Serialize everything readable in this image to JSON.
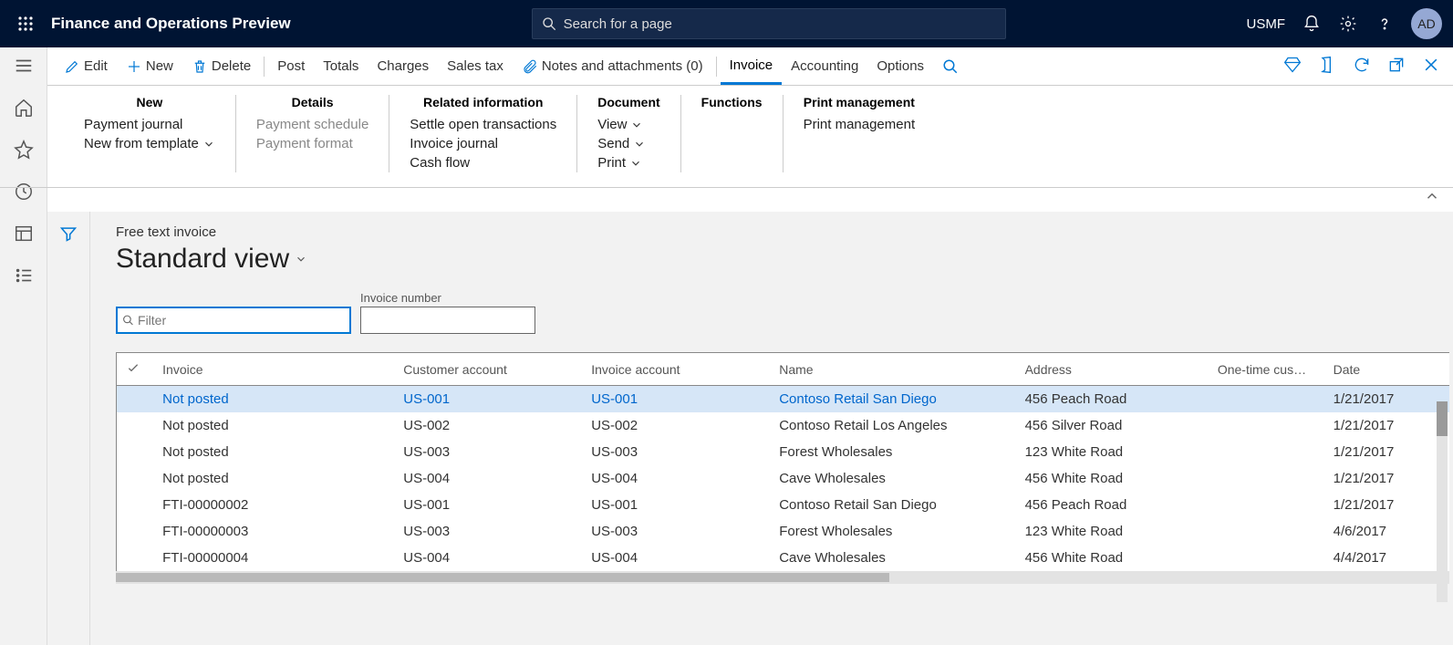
{
  "header": {
    "app_title": "Finance and Operations Preview",
    "search_placeholder": "Search for a page",
    "company": "USMF",
    "avatar": "AD"
  },
  "actionbar": {
    "edit": "Edit",
    "new": "New",
    "delete": "Delete",
    "post": "Post",
    "totals": "Totals",
    "charges": "Charges",
    "salestax": "Sales tax",
    "attachments": "Notes and attachments (0)",
    "invoice": "Invoice",
    "accounting": "Accounting",
    "options": "Options"
  },
  "ribbon": {
    "groups": [
      {
        "head": "New",
        "items": [
          {
            "label": "Payment journal",
            "disabled": false
          },
          {
            "label": "New from template",
            "disabled": false,
            "chevron": true
          }
        ]
      },
      {
        "head": "Details",
        "items": [
          {
            "label": "Payment schedule",
            "disabled": true
          },
          {
            "label": "Payment format",
            "disabled": true
          }
        ]
      },
      {
        "head": "Related information",
        "items": [
          {
            "label": "Settle open transactions"
          },
          {
            "label": "Invoice journal"
          },
          {
            "label": "Cash flow"
          }
        ]
      },
      {
        "head": "Document",
        "items": [
          {
            "label": "View",
            "chevron": true
          },
          {
            "label": "Send",
            "chevron": true
          },
          {
            "label": "Print",
            "chevron": true
          }
        ]
      },
      {
        "head": "Functions",
        "items": []
      },
      {
        "head": "Print management",
        "items": [
          {
            "label": "Print management"
          }
        ]
      }
    ]
  },
  "page": {
    "breadcrumb": "Free text invoice",
    "view": "Standard view",
    "filter_placeholder": "Filter",
    "invoice_number_label": "Invoice number"
  },
  "grid": {
    "columns": [
      "Invoice",
      "Customer account",
      "Invoice account",
      "Name",
      "Address",
      "One-time cus…",
      "Date"
    ],
    "rows": [
      {
        "invoice": "Not posted",
        "cust": "US-001",
        "invacc": "US-001",
        "name": "Contoso Retail San Diego",
        "addr": "456 Peach Road",
        "date": "1/21/2017",
        "selected": true,
        "allLink": true
      },
      {
        "invoice": "Not posted",
        "cust": "US-002",
        "invacc": "US-002",
        "name": "Contoso Retail Los Angeles",
        "addr": "456 Silver Road",
        "date": "1/21/2017"
      },
      {
        "invoice": "Not posted",
        "cust": "US-003",
        "invacc": "US-003",
        "name": "Forest Wholesales",
        "addr": "123 White Road",
        "date": "1/21/2017"
      },
      {
        "invoice": "Not posted",
        "cust": "US-004",
        "invacc": "US-004",
        "name": "Cave Wholesales",
        "addr": "456 White Road",
        "date": "1/21/2017"
      },
      {
        "invoice": "FTI-00000002",
        "cust": "US-001",
        "invacc": "US-001",
        "name": "Contoso Retail San Diego",
        "addr": "456 Peach Road",
        "date": "1/21/2017"
      },
      {
        "invoice": "FTI-00000003",
        "cust": "US-003",
        "invacc": "US-003",
        "name": "Forest Wholesales",
        "addr": "123 White Road",
        "date": "4/6/2017"
      },
      {
        "invoice": "FTI-00000004",
        "cust": "US-004",
        "invacc": "US-004",
        "name": "Cave Wholesales",
        "addr": "456 White Road",
        "date": "4/4/2017"
      }
    ]
  }
}
